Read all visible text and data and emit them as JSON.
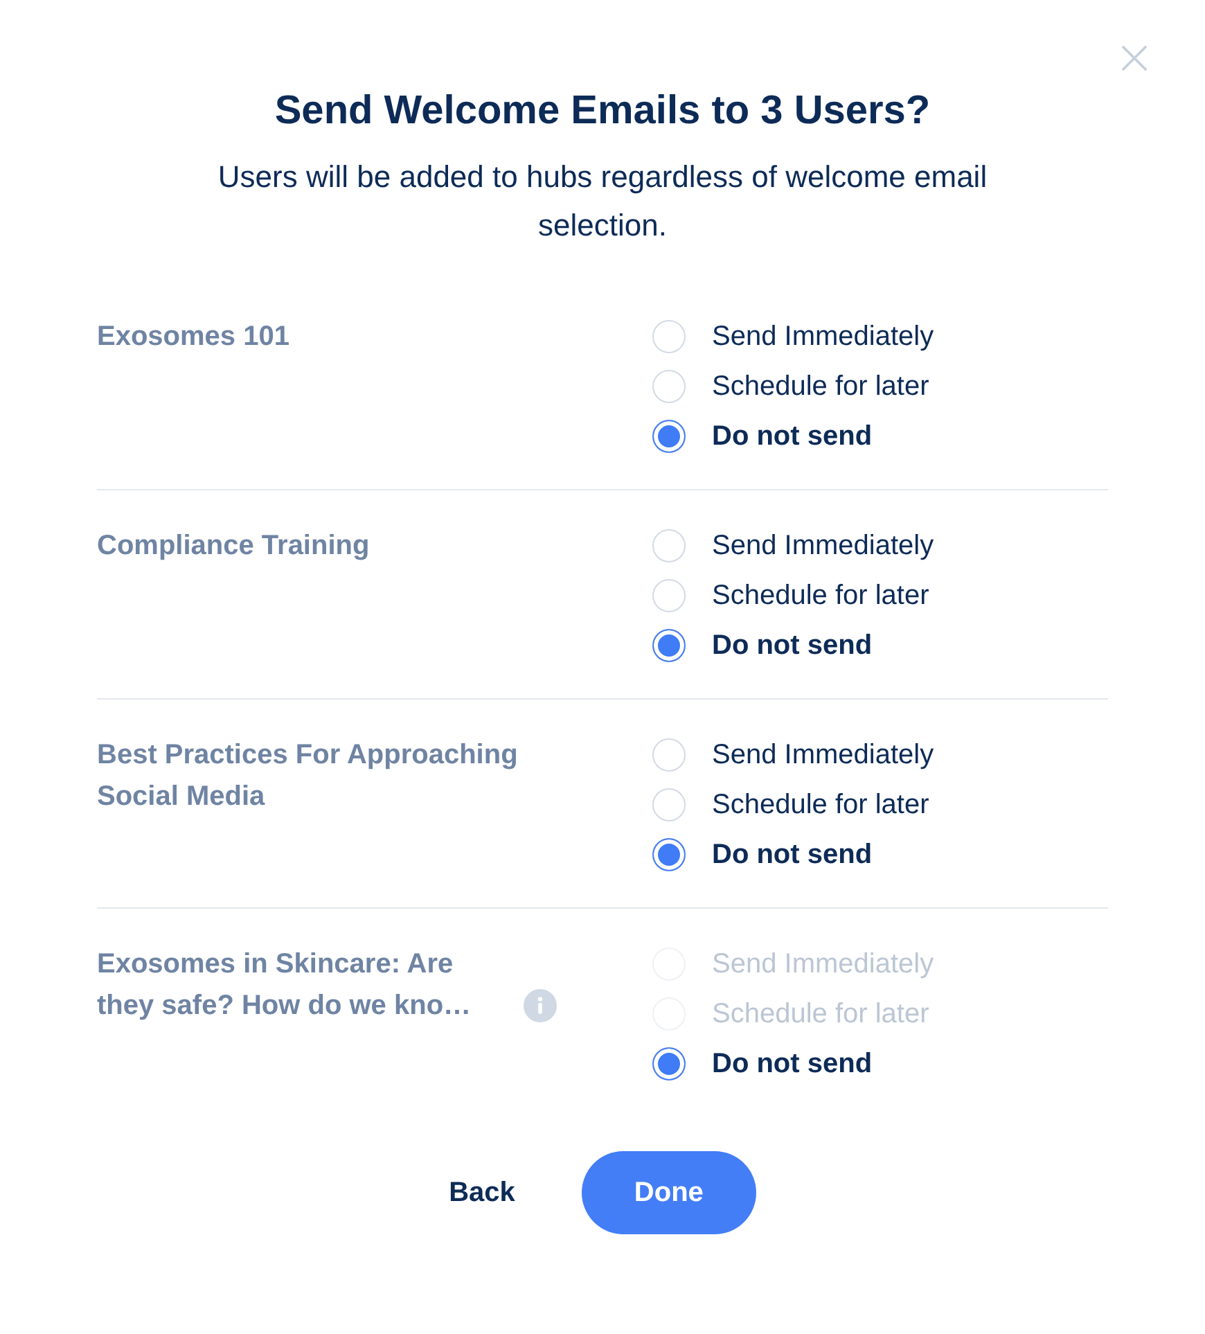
{
  "dialog": {
    "title": "Send Welcome Emails to 3 Users?",
    "subtitle": "Users will be added to hubs regardless of welcome email selection."
  },
  "hubs": [
    {
      "name": "Exosomes 101",
      "info": false,
      "options": [
        {
          "label": "Send Immediately",
          "selected": false,
          "disabled": false
        },
        {
          "label": "Schedule for later",
          "selected": false,
          "disabled": false
        },
        {
          "label": "Do not send",
          "selected": true,
          "disabled": false
        }
      ]
    },
    {
      "name": "Compliance Training",
      "info": false,
      "options": [
        {
          "label": "Send Immediately",
          "selected": false,
          "disabled": false
        },
        {
          "label": "Schedule for later",
          "selected": false,
          "disabled": false
        },
        {
          "label": "Do not send",
          "selected": true,
          "disabled": false
        }
      ]
    },
    {
      "name": "Best Practices For Approaching Social Media",
      "info": false,
      "options": [
        {
          "label": "Send Immediately",
          "selected": false,
          "disabled": false
        },
        {
          "label": "Schedule for later",
          "selected": false,
          "disabled": false
        },
        {
          "label": "Do not send",
          "selected": true,
          "disabled": false
        }
      ]
    },
    {
      "name": "Exosomes in Skincare: Are they safe? How do we kno…",
      "info": true,
      "options": [
        {
          "label": "Send Immediately",
          "selected": false,
          "disabled": true
        },
        {
          "label": "Schedule for later",
          "selected": false,
          "disabled": true
        },
        {
          "label": "Do not send",
          "selected": true,
          "disabled": false
        }
      ]
    }
  ],
  "buttons": [
    {
      "label": "Back",
      "kind": "text"
    },
    {
      "label": "Done",
      "kind": "primary"
    }
  ]
}
